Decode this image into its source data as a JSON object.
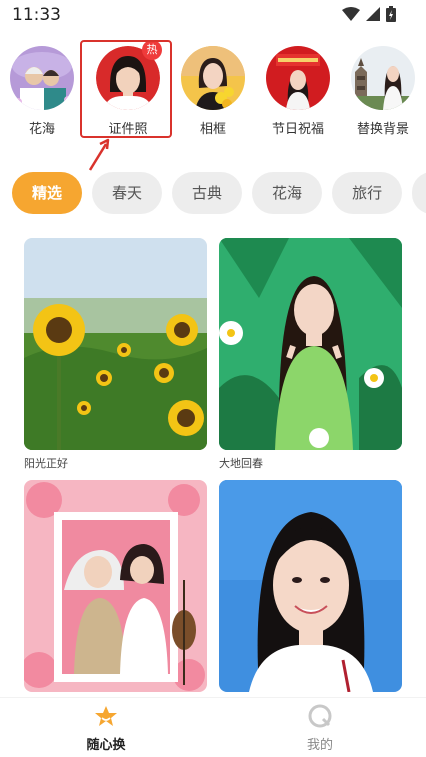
{
  "status": {
    "time": "11:33"
  },
  "categories": [
    {
      "label": "花海"
    },
    {
      "label": "证件照",
      "badge": "热"
    },
    {
      "label": "相框"
    },
    {
      "label": "节日祝福"
    },
    {
      "label": "替换背景"
    }
  ],
  "tabs": [
    {
      "label": "精选",
      "active": true
    },
    {
      "label": "春天"
    },
    {
      "label": "古典"
    },
    {
      "label": "花海"
    },
    {
      "label": "旅行"
    }
  ],
  "cards": [
    {
      "title": "阳光正好"
    },
    {
      "title": "大地回春"
    },
    {
      "title": ""
    },
    {
      "title": ""
    }
  ],
  "bottom_nav": [
    {
      "label": "随心换",
      "active": true
    },
    {
      "label": "我的"
    }
  ],
  "colors": {
    "accent": "#f6a630",
    "highlight": "#d9322c",
    "badge": "#ef3b3b"
  }
}
